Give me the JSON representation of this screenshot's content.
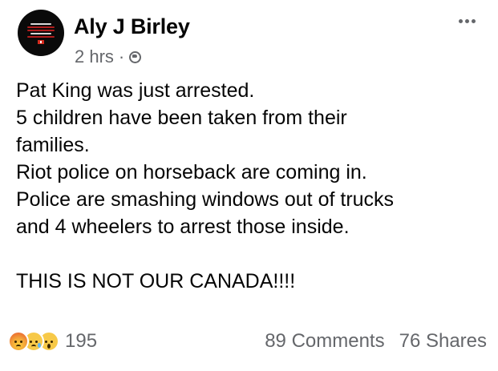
{
  "post": {
    "author": "Aly J Birley",
    "time": "2 hrs",
    "separator": "·",
    "privacy_icon": "globe-icon",
    "more_icon": "more-horizontal-icon",
    "lines": [
      "Pat King was just arrested.",
      "5 children have been taken from their",
      "families.",
      "Riot police on horseback are coming in.",
      "Police are smashing windows out of trucks",
      "and 4 wheelers to arrest those inside.",
      "",
      "THIS IS NOT OUR CANADA!!!!"
    ]
  },
  "footer": {
    "reaction_icons": [
      "angry-reaction-icon",
      "sad-reaction-icon",
      "wow-reaction-icon"
    ],
    "reaction_count": "195",
    "comments": "89 Comments",
    "shares": "76 Shares"
  },
  "colors": {
    "text": "#050505",
    "secondary": "#65676b",
    "background": "#ffffff"
  }
}
